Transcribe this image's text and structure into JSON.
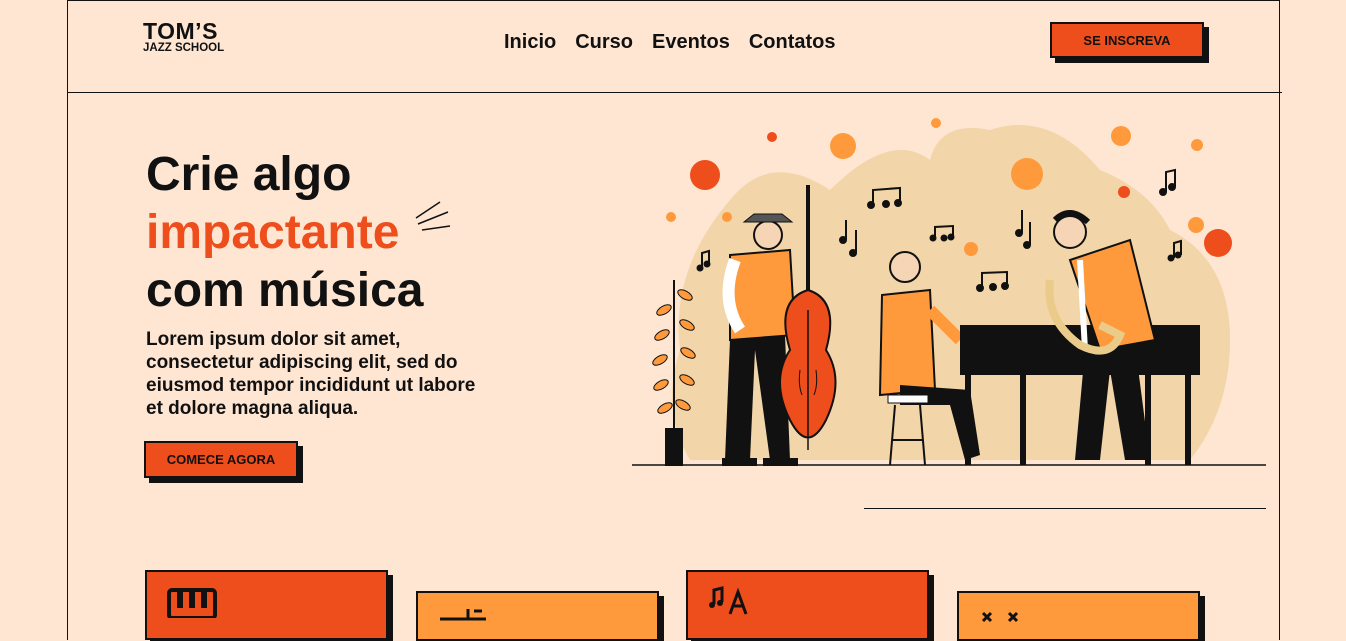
{
  "brand": {
    "name": "TOM’S",
    "subtitle": "JAZZ SCHOOL"
  },
  "nav": {
    "items": [
      {
        "label": "Inicio"
      },
      {
        "label": "Curso"
      },
      {
        "label": "Eventos"
      },
      {
        "label": "Contatos"
      }
    ]
  },
  "header": {
    "cta_label": "SE INSCREVA"
  },
  "hero": {
    "line1": "Crie algo",
    "line2": "impactante",
    "line3": "com música",
    "description": "Lorem ipsum dolor sit amet, consectetur adipiscing elit, sed do eiusmod tempor incididunt ut labore et dolore magna aliqua.",
    "cta_label": "COMECE AGORA"
  },
  "cards": [
    {
      "icon": "piano-keys-icon",
      "color": "#ee4d1c"
    },
    {
      "icon": "music-staff-icon",
      "color": "#ff9a3c"
    },
    {
      "icon": "jazz-notes-icon",
      "color": "#ee4d1c"
    },
    {
      "icon": "instruments-icon",
      "color": "#ff9a3c"
    }
  ],
  "colors": {
    "background": "#ffe6d3",
    "accent": "#ee4d1c",
    "secondary": "#ff9a3c",
    "blob": "#f2d5a8"
  }
}
